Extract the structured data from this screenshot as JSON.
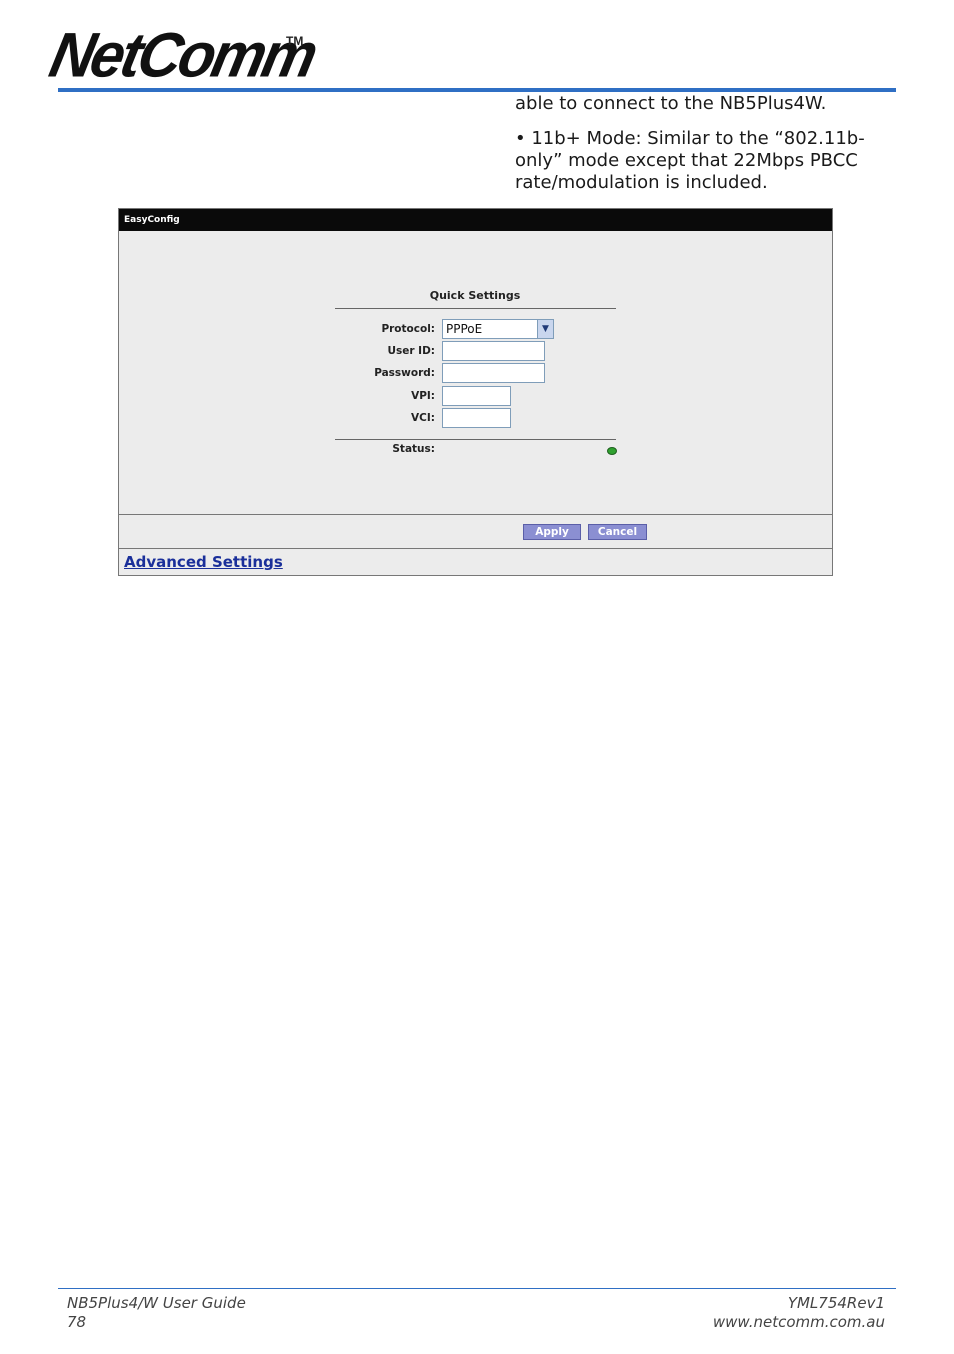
{
  "header": {
    "logo_text": "NetComm",
    "logo_tm": "TM",
    "accent_color": "#2f6fc4"
  },
  "body": {
    "line1": "able to connect to the NB5Plus4W.",
    "bullet": "• 11b+ Mode: Similar to the “802.11b-only” mode except that 22Mbps PBCC rate/modulation is included."
  },
  "screenshot": {
    "window_title": "EasyConfig",
    "section_title": "Quick Settings",
    "fields": {
      "protocol_label": "Protocol:",
      "protocol_value": "PPPoE",
      "user_id_label": "User ID:",
      "user_id_value": "",
      "password_label": "Password:",
      "password_value": "",
      "vpi_label": "VPI:",
      "vpi_value": "",
      "vci_label": "VCI:",
      "vci_value": ""
    },
    "status_label": "Status:",
    "status_color": "#2fa12f",
    "apply_label": "Apply",
    "cancel_label": "Cancel",
    "advanced_link": "Advanced Settings",
    "icons": {
      "dropdown": "chevron-down-icon",
      "status": "status-led-icon"
    }
  },
  "footer": {
    "guide_title": "NB5Plus4/W User Guide",
    "page_number": "78",
    "doc_code": "YML754Rev1",
    "website": "www.netcomm.com.au"
  }
}
